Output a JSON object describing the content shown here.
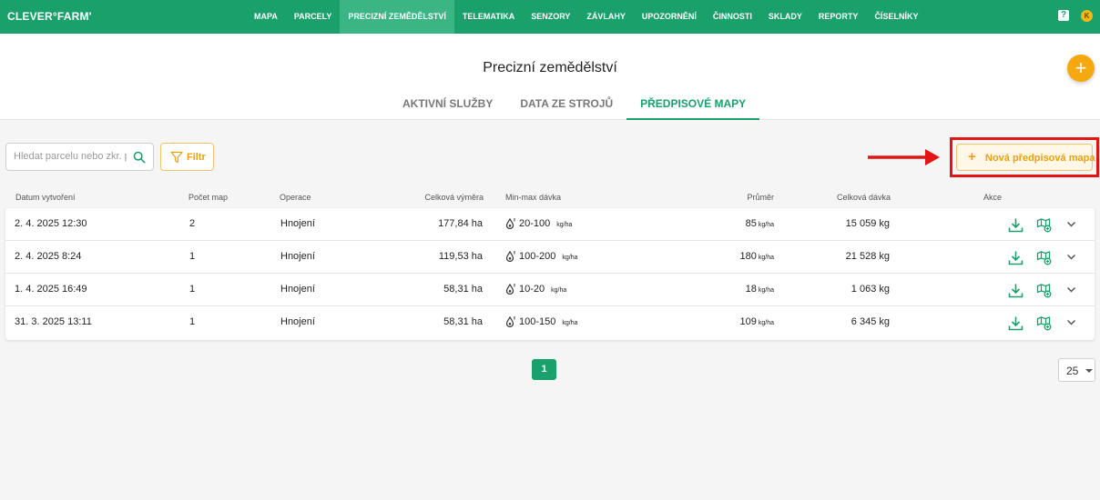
{
  "app": {
    "logo": "CLEVER°FARM'",
    "nav": [
      {
        "label": "MAPA",
        "active": false
      },
      {
        "label": "PARCELY",
        "active": false
      },
      {
        "label": "PRECIZNÍ ZEMĚDĚLSTVÍ",
        "active": true
      },
      {
        "label": "TELEMATIKA",
        "active": false
      },
      {
        "label": "SENZORY",
        "active": false
      },
      {
        "label": "ZÁVLAHY",
        "active": false
      },
      {
        "label": "UPOZORNĚNÍ",
        "active": false
      },
      {
        "label": "ČINNOSTI",
        "active": false
      },
      {
        "label": "SKLADY",
        "active": false
      },
      {
        "label": "REPORTY",
        "active": false
      },
      {
        "label": "ČÍSELNÍKY",
        "active": false
      }
    ],
    "help_label": "?",
    "avatar_initial": "K",
    "brand_color": "#1aa06a",
    "accent_color": "#f5a90f"
  },
  "page": {
    "title": "Precizní zemědělství",
    "fab_label": "+",
    "tabs": [
      {
        "label": "AKTIVNÍ SLUŽBY",
        "active": false
      },
      {
        "label": "DATA ZE STROJŮ",
        "active": false
      },
      {
        "label": "PŘEDPISOVÉ MAPY",
        "active": true
      }
    ]
  },
  "toolbar": {
    "search_placeholder": "Hledat parcelu nebo zkr. p",
    "search_value": "",
    "filter_label": "Filtr",
    "new_label": "Nová předpisová mapa",
    "new_plus": "+",
    "highlight_color": "#e41414"
  },
  "table": {
    "headers": {
      "date": "Datum vytvoření",
      "count": "Počet map",
      "operation": "Operace",
      "area": "Celková výměra",
      "minmax": "Min-max dávka",
      "avg": "Průměr",
      "total": "Celková dávka",
      "actions": "Akce"
    },
    "rows": [
      {
        "date": "2. 4. 2025 12:30",
        "count": "2",
        "operation": "Hnojení",
        "area": "177,84 ha",
        "minmax": "20-100",
        "minmax_unit": "kg/ha",
        "avg": "85",
        "avg_unit": "kg/ha",
        "total": "15 059 kg"
      },
      {
        "date": "2. 4. 2025 8:24",
        "count": "1",
        "operation": "Hnojení",
        "area": "119,53 ha",
        "minmax": "100-200",
        "minmax_unit": "kg/ha",
        "avg": "180",
        "avg_unit": "kg/ha",
        "total": "21 528 kg"
      },
      {
        "date": "1. 4. 2025 16:49",
        "count": "1",
        "operation": "Hnojení",
        "area": "58,31 ha",
        "minmax": "10-20",
        "minmax_unit": "kg/ha",
        "avg": "18",
        "avg_unit": "kg/ha",
        "total": "1 063 kg"
      },
      {
        "date": "31. 3. 2025 13:11",
        "count": "1",
        "operation": "Hnojení",
        "area": "58,31 ha",
        "minmax": "100-150",
        "minmax_unit": "kg/ha",
        "avg": "109",
        "avg_unit": "kg/ha",
        "total": "6 345 kg"
      }
    ]
  },
  "pagination": {
    "current_page": "1",
    "per_page": "25"
  }
}
